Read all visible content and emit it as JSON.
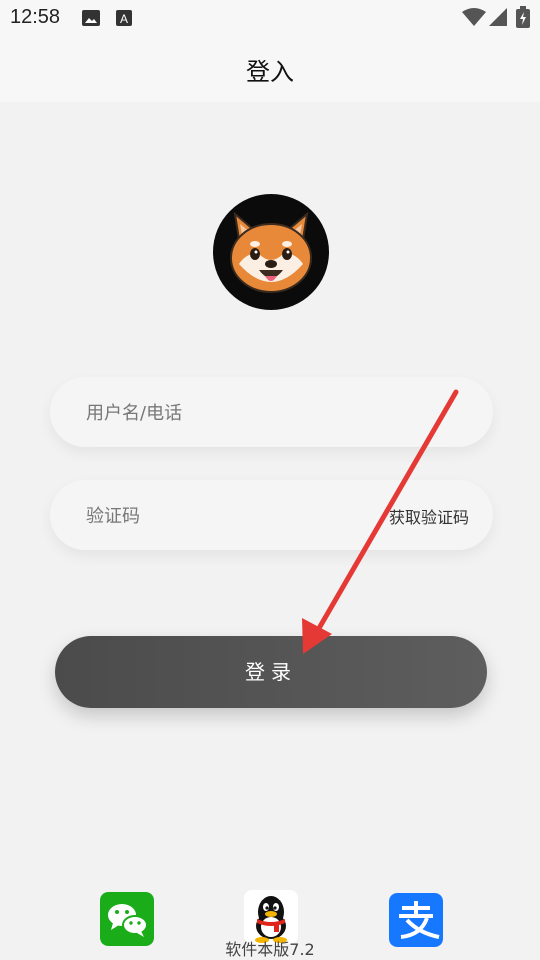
{
  "status_bar": {
    "time": "12:58",
    "icons": [
      "image-icon",
      "a-text-icon",
      "wifi-icon",
      "signal-icon",
      "battery-charging-icon"
    ]
  },
  "header": {
    "title": "登入"
  },
  "login_form": {
    "avatar_icon": "shiba-dog-avatar",
    "username_placeholder": "用户名/电话",
    "code_placeholder": "验证码",
    "get_code_label": "获取验证码",
    "login_button_label": "登录"
  },
  "social_login": {
    "items": [
      "wechat-icon",
      "qq-icon",
      "alipay-icon"
    ],
    "colors": {
      "wechat": "#1aad19",
      "alipay": "#1677ff"
    }
  },
  "footer": {
    "version": "软件本版7.2"
  },
  "annotation": {
    "arrow_color": "#e53935"
  }
}
